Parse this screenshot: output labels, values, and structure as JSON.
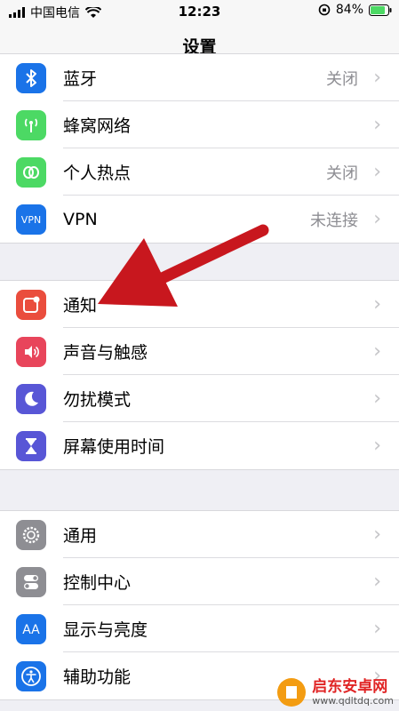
{
  "status_bar": {
    "carrier": "中国电信",
    "time": "12:23",
    "battery": "84%"
  },
  "nav": {
    "title": "设置"
  },
  "groups": [
    {
      "rows": [
        {
          "label": "蓝牙",
          "value": "关闭",
          "icon": "bluetooth-icon",
          "color": "#1a73e8"
        },
        {
          "label": "蜂窝网络",
          "value": "",
          "icon": "cellular-icon",
          "color": "#4cd964"
        },
        {
          "label": "个人热点",
          "value": "关闭",
          "icon": "hotspot-icon",
          "color": "#4cd964"
        },
        {
          "label": "VPN",
          "value": "未连接",
          "icon": "vpn-icon",
          "color": "#1a73e8"
        }
      ]
    },
    {
      "rows": [
        {
          "label": "通知",
          "value": "",
          "icon": "notifications-icon",
          "color": "#ea4d3d"
        },
        {
          "label": "声音与触感",
          "value": "",
          "icon": "sound-icon",
          "color": "#e8455b"
        },
        {
          "label": "勿扰模式",
          "value": "",
          "icon": "moon-icon",
          "color": "#5856d6"
        },
        {
          "label": "屏幕使用时间",
          "value": "",
          "icon": "hourglass-icon",
          "color": "#5856d6"
        }
      ]
    },
    {
      "rows": [
        {
          "label": "通用",
          "value": "",
          "icon": "gear-icon",
          "color": "#8e8e93"
        },
        {
          "label": "控制中心",
          "value": "",
          "icon": "toggles-icon",
          "color": "#8e8e93"
        },
        {
          "label": "显示与亮度",
          "value": "",
          "icon": "text-size-icon",
          "color": "#1a73e8"
        },
        {
          "label": "辅助功能",
          "value": "",
          "icon": "accessibility-icon",
          "color": "#1a73e8"
        }
      ]
    }
  ],
  "watermark": {
    "name": "启东安卓网",
    "url": "www.qdltdq.com"
  }
}
